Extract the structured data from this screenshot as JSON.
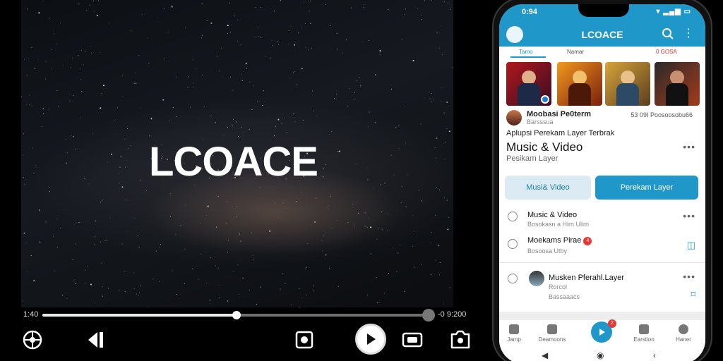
{
  "player": {
    "logo_text": "LCOACE",
    "time_current": "1:40",
    "time_total": "-0 9:200",
    "progress_fraction": 0.5,
    "controls": [
      "network-icon",
      "previous-icon",
      "stop-icon",
      "play-icon",
      "screen-icon",
      "camera-icon"
    ]
  },
  "phone": {
    "status_time": "0:94",
    "app_title": "LCOACE",
    "tabs": [
      "Tamo",
      "Namar",
      "0 GOSA"
    ],
    "channel": {
      "name": "Moobasi Pe0term",
      "sub": "Barsssua",
      "meta": "53 09I Poosoosobu66"
    },
    "headline": "Aplupsi Perekam Layer Terbrak",
    "title": "Music & Video",
    "subtitle": "Pesikarn Layer",
    "buttons": {
      "secondary": "Musi& Video",
      "primary": "Perekam Layer"
    },
    "list": [
      {
        "title": "Music & Video",
        "sub": "Bosokasn a Hirn Ulirn"
      },
      {
        "title": "Moekams Pirae",
        "sub": "Bosoosa Utby",
        "badge": "4"
      },
      {
        "title": "Musken Pferahl.Layer",
        "sub": "Rorcol",
        "sub2": "Bassaaacs"
      }
    ],
    "nav": [
      "Jamp",
      "Deamoons",
      "Earstion",
      "Haner"
    ],
    "nav_badge": "2",
    "colors": {
      "accent": "#1f97c9",
      "badge": "#e53935"
    }
  }
}
